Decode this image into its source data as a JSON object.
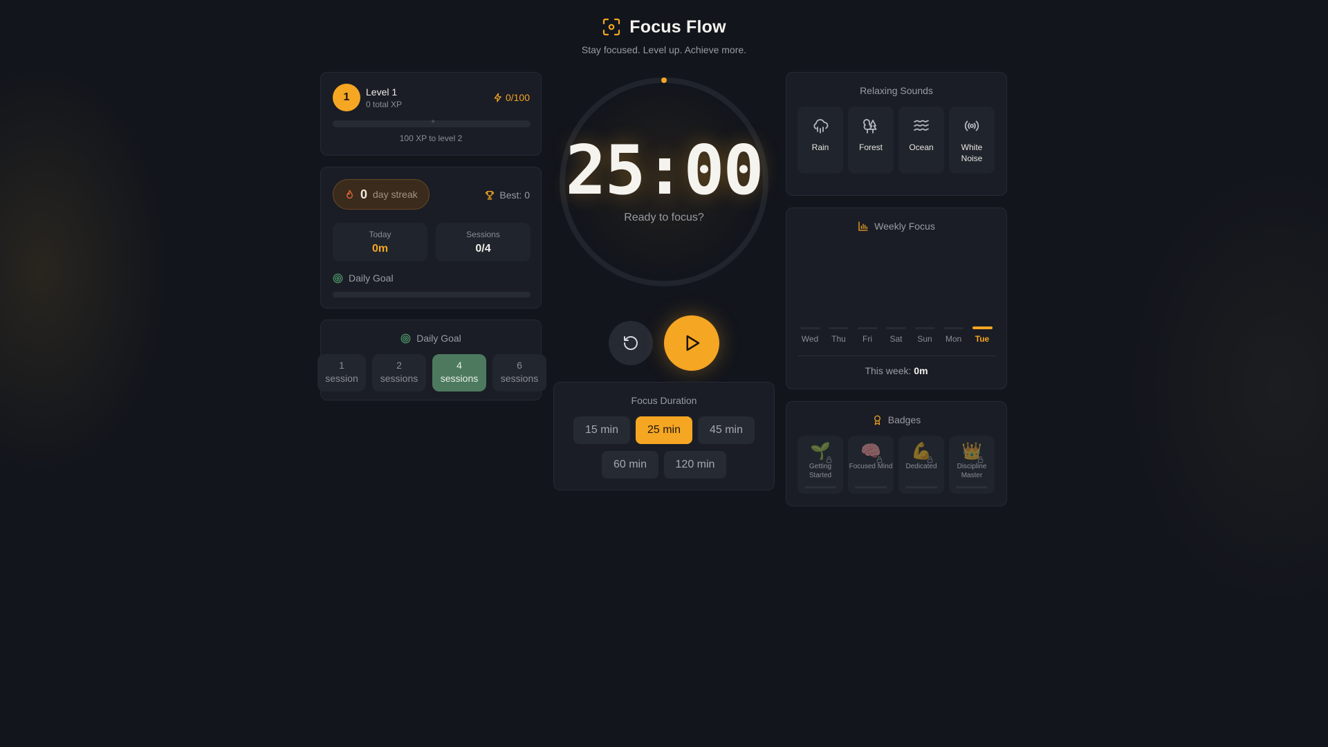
{
  "app": {
    "title": "Focus Flow",
    "subtitle": "Stay focused. Level up. Achieve more."
  },
  "colors": {
    "accent": "#f5a623",
    "goal_green": "#4d7a5f",
    "background": "#12151c",
    "card": "#1a1d25"
  },
  "level": {
    "number": "1",
    "name": "Level 1",
    "total_xp": "0 total XP",
    "xp_progress": "0/100",
    "xp_fraction": 0,
    "to_next": "100 XP to level 2"
  },
  "streak": {
    "count": "0",
    "label": "day streak",
    "best": "Best: 0",
    "today_label": "Today",
    "today_value": "0m",
    "sessions_label": "Sessions",
    "sessions_value": "0/4",
    "daily_goal_label": "Daily Goal",
    "daily_goal_fraction": 0
  },
  "daily_goal": {
    "title": "Daily Goal",
    "options": [
      {
        "num": "1",
        "unit": "session"
      },
      {
        "num": "2",
        "unit": "sessions"
      },
      {
        "num": "4",
        "unit": "sessions"
      },
      {
        "num": "6",
        "unit": "sessions"
      }
    ],
    "selected": 2
  },
  "timer": {
    "display": "25:00",
    "status": "Ready to focus?",
    "progress_fraction": 0
  },
  "duration": {
    "title": "Focus Duration",
    "options": [
      "15 min",
      "25 min",
      "45 min",
      "60 min",
      "120 min"
    ],
    "selected": 1
  },
  "sounds": {
    "title": "Relaxing Sounds",
    "items": [
      {
        "label": "Rain",
        "icon": "cloud-rain-icon"
      },
      {
        "label": "Forest",
        "icon": "trees-icon"
      },
      {
        "label": "Ocean",
        "icon": "waves-icon"
      },
      {
        "label": "White Noise",
        "icon": "radio-icon"
      }
    ]
  },
  "weekly": {
    "title": "Weekly Focus",
    "days": [
      "Wed",
      "Thu",
      "Fri",
      "Sat",
      "Sun",
      "Mon",
      "Tue"
    ],
    "minutes": [
      0,
      0,
      0,
      0,
      0,
      0,
      0
    ],
    "today_index": 6,
    "total_label": "This week:",
    "total_value": "0m"
  },
  "badges": {
    "title": "Badges",
    "items": [
      {
        "emoji": "🌱",
        "name": "Getting Started",
        "locked": true
      },
      {
        "emoji": "🧠",
        "name": "Focused Mind",
        "locked": true
      },
      {
        "emoji": "💪",
        "name": "Dedicated",
        "locked": true
      },
      {
        "emoji": "👑",
        "name": "Discipline Master",
        "locked": true
      }
    ]
  }
}
